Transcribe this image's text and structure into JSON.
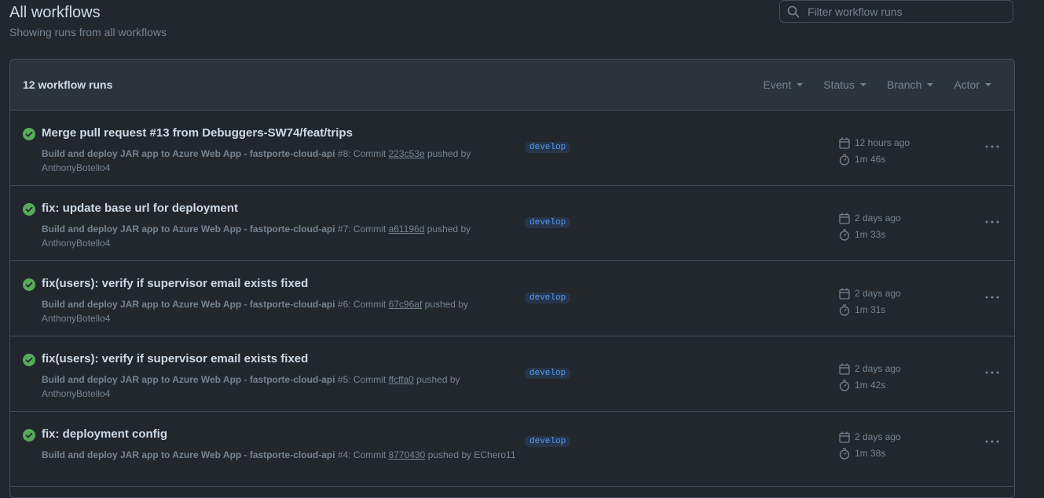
{
  "header": {
    "title": "All workflows",
    "subtitle": "Showing runs from all workflows"
  },
  "search": {
    "placeholder": "Filter workflow runs"
  },
  "list": {
    "count_label": "12 workflow runs",
    "filters": [
      {
        "label": "Event"
      },
      {
        "label": "Status"
      },
      {
        "label": "Branch"
      },
      {
        "label": "Actor"
      }
    ]
  },
  "runs": [
    {
      "status": "success",
      "title": "Merge pull request #13 from Debuggers-SW74/feat/trips",
      "workflow": "Build and deploy JAR app to Azure Web App - fastporte-cloud-api",
      "run_number": " #8: Commit ",
      "sha": "223c53e",
      "pushed_by": " pushed by ",
      "actor": "AnthonyBotello4",
      "branch": "develop",
      "time": "12 hours ago",
      "duration": "1m 46s"
    },
    {
      "status": "success",
      "title": "fix: update base url for deployment",
      "workflow": "Build and deploy JAR app to Azure Web App - fastporte-cloud-api",
      "run_number": " #7: Commit ",
      "sha": "a61196d",
      "pushed_by": " pushed by ",
      "actor": "AnthonyBotello4",
      "branch": "develop",
      "time": "2 days ago",
      "duration": "1m 33s"
    },
    {
      "status": "success",
      "title": "fix(users): verify if supervisor email exists fixed",
      "workflow": "Build and deploy JAR app to Azure Web App - fastporte-cloud-api",
      "run_number": " #6: Commit ",
      "sha": "67c96af",
      "pushed_by": " pushed by ",
      "actor": "AnthonyBotello4",
      "branch": "develop",
      "time": "2 days ago",
      "duration": "1m 31s"
    },
    {
      "status": "success",
      "title": "fix(users): verify if supervisor email exists fixed",
      "workflow": "Build and deploy JAR app to Azure Web App - fastporte-cloud-api",
      "run_number": " #5: Commit ",
      "sha": "ffcffa0",
      "pushed_by": " pushed by ",
      "actor": "AnthonyBotello4",
      "branch": "develop",
      "time": "2 days ago",
      "duration": "1m 42s"
    },
    {
      "status": "success",
      "title": "fix: deployment config",
      "workflow": "Build and deploy JAR app to Azure Web App - fastporte-cloud-api",
      "run_number": " #4: Commit ",
      "sha": "8770430",
      "pushed_by": " pushed by ",
      "actor": "EChero11",
      "branch": "develop",
      "time": "2 days ago",
      "duration": "1m 38s"
    }
  ],
  "colors": {
    "background": "#22272e",
    "header_bg": "#2d333b",
    "success": "#57ab5a",
    "branch_text": "#539bf5"
  },
  "icons": {
    "search": "search-icon",
    "status": "check-circle-fill-icon",
    "calendar": "calendar-icon",
    "stopwatch": "stopwatch-icon",
    "menu": "kebab-horizontal-icon"
  }
}
